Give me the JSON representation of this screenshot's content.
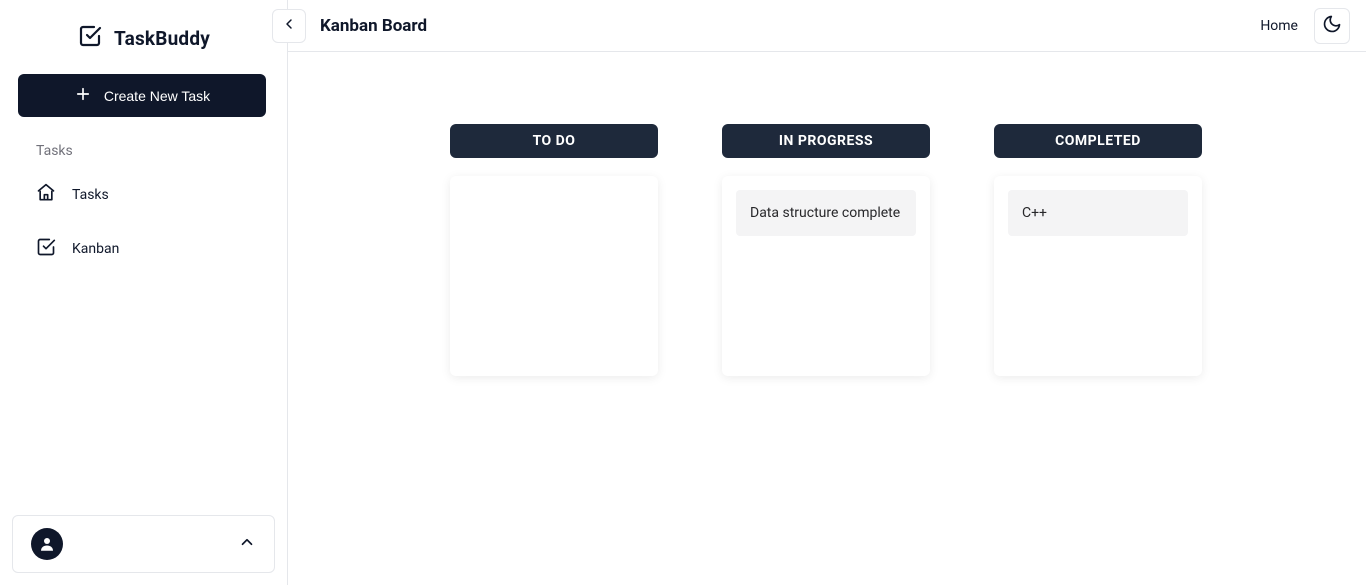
{
  "app": {
    "name": "TaskBuddy"
  },
  "sidebar": {
    "create_label": "Create New Task",
    "section_label": "Tasks",
    "items": [
      {
        "label": "Tasks"
      },
      {
        "label": "Kanban"
      }
    ]
  },
  "topbar": {
    "title": "Kanban Board",
    "home_label": "Home"
  },
  "board": {
    "columns": [
      {
        "title": "TO DO",
        "cards": []
      },
      {
        "title": "IN PROGRESS",
        "cards": [
          "Data structure complete"
        ]
      },
      {
        "title": "COMPLETED",
        "cards": [
          "C++"
        ]
      }
    ]
  }
}
